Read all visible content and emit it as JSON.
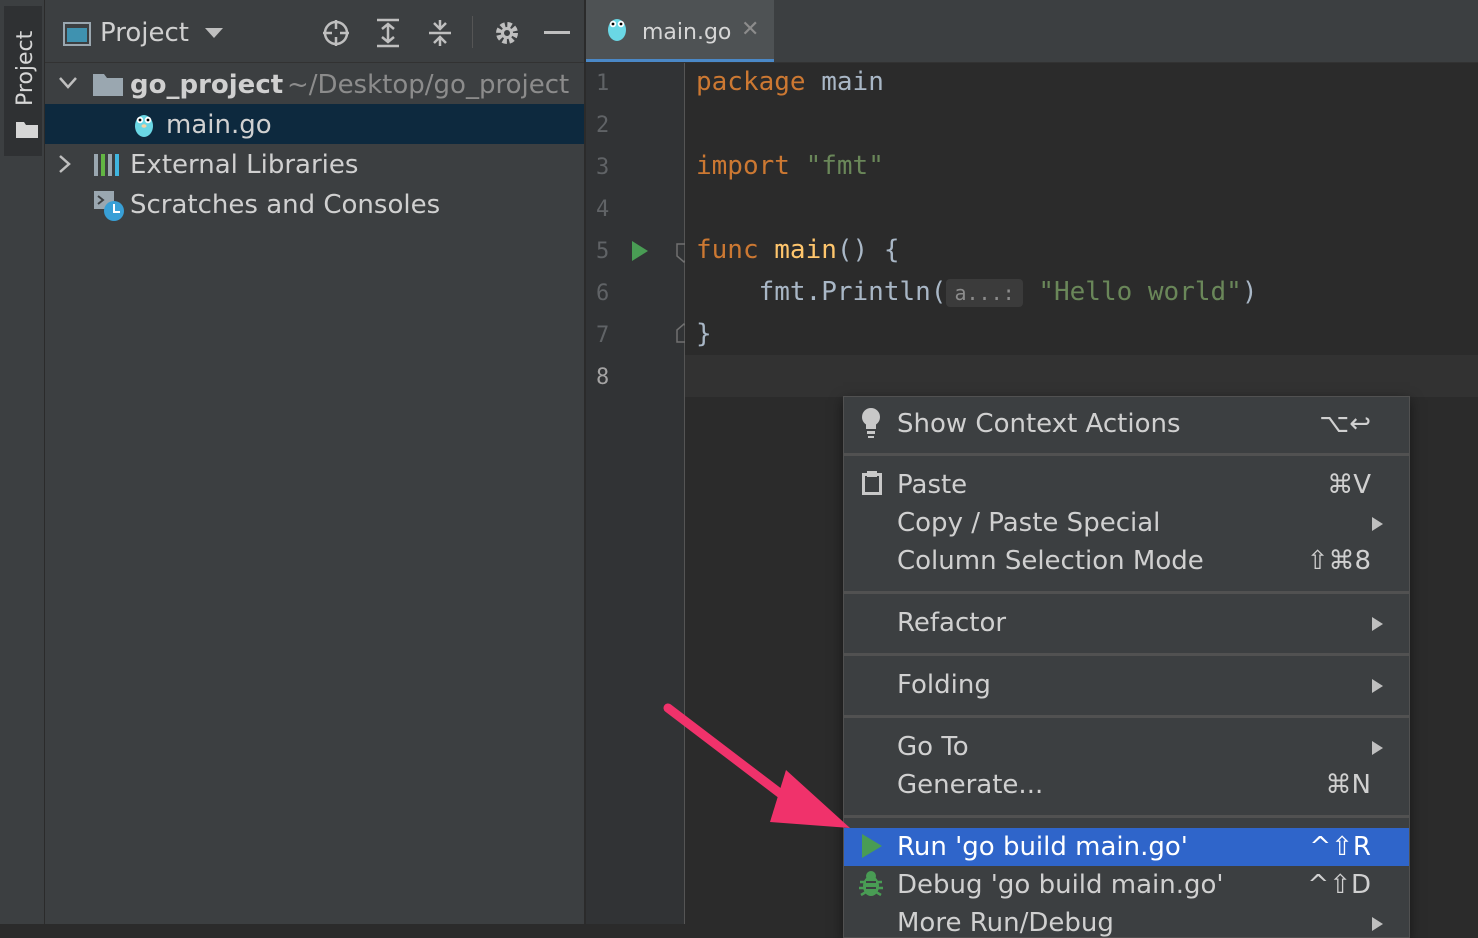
{
  "stripe": {
    "label": "Project"
  },
  "project_panel": {
    "title": "Project",
    "tree": [
      {
        "label": "go_project",
        "sub": "~/Desktop/go_project"
      },
      {
        "label": "main.go"
      },
      {
        "label": "External Libraries"
      },
      {
        "label": "Scratches and Consoles"
      }
    ]
  },
  "editor": {
    "tab": {
      "label": "main.go",
      "close": "✕"
    },
    "line_numbers": [
      "1",
      "2",
      "3",
      "4",
      "5",
      "6",
      "7",
      "8"
    ],
    "code": {
      "l1_kw": "package",
      "l1_rest": " main",
      "l3_kw": "import",
      "l3_str": " \"fmt\"",
      "l5_kw": "func",
      "l5_fn": " main",
      "l5_rest": "() {",
      "l6_pre": "    fmt.Println(",
      "l6_hint": "a...:",
      "l6_str": "\"Hello world\"",
      "l6_post": ")",
      "l7": "}"
    }
  },
  "context_menu": {
    "items": [
      {
        "label": "Show Context Actions",
        "shortcut": "⌥↩"
      },
      {
        "label": "Paste",
        "shortcut": "⌘V"
      },
      {
        "label": "Copy / Paste Special"
      },
      {
        "label": "Column Selection Mode",
        "shortcut": "⇧⌘8"
      },
      {
        "label": "Refactor"
      },
      {
        "label": "Folding"
      },
      {
        "label": "Go To"
      },
      {
        "label": "Generate...",
        "shortcut": "⌘N"
      },
      {
        "label": "Run 'go build main.go'",
        "shortcut": "^⇧R"
      },
      {
        "label": "Debug 'go build main.go'",
        "shortcut": "^⇧D"
      },
      {
        "label": "More Run/Debug"
      }
    ]
  },
  "colors": {
    "selection": "#2f65ca",
    "run_green": "#499c54",
    "annotation_arrow": "#f0326b"
  }
}
